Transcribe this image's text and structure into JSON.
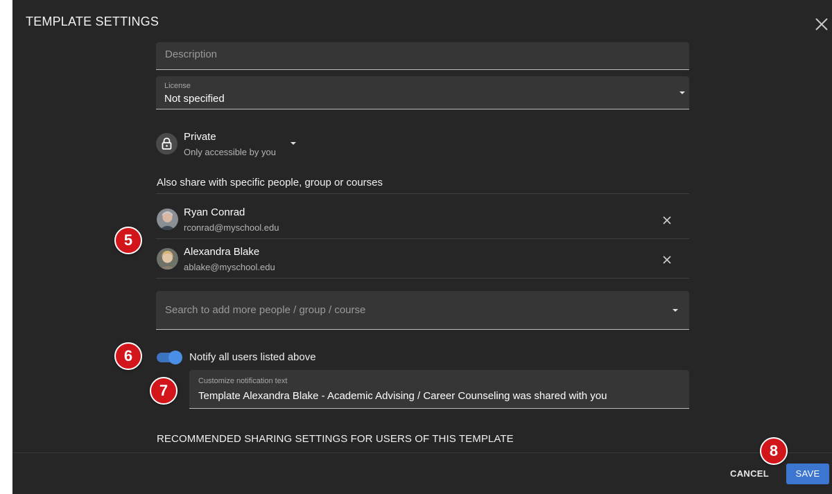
{
  "dialog": {
    "title": "TEMPLATE SETTINGS"
  },
  "form": {
    "description_placeholder": "Description",
    "license": {
      "label": "License",
      "value": "Not specified"
    },
    "privacy": {
      "title": "Private",
      "subtitle": "Only accessible by you"
    },
    "share_heading": "Also share with specific people, group or courses",
    "people": [
      {
        "name": "Ryan Conrad",
        "email": "rconrad@myschool.edu"
      },
      {
        "name": "Alexandra Blake",
        "email": "ablake@myschool.edu"
      }
    ],
    "search_placeholder": "Search to add more people / group / course",
    "notify": {
      "label": "Notify all users listed above",
      "enabled": true
    },
    "notification_text": {
      "label": "Customize notification text",
      "value": "Template Alexandra Blake - Academic Advising / Career Counseling was shared with you"
    },
    "recommended_heading": "RECOMMENDED SHARING SETTINGS FOR USERS OF THIS TEMPLATE"
  },
  "badges": {
    "b5": "5",
    "b6": "6",
    "b7": "7",
    "b8": "8"
  },
  "footer": {
    "cancel_label": "CANCEL",
    "save_label": "SAVE"
  },
  "colors": {
    "dialog_bg": "#262626",
    "field_bg": "#363636",
    "accent": "#3c76d1",
    "badge": "#d2151b"
  },
  "icons": {
    "close": "close-icon",
    "dropdown": "chevron-down-icon",
    "lock": "lock-icon",
    "remove": "close-icon",
    "avatar": "avatar"
  }
}
